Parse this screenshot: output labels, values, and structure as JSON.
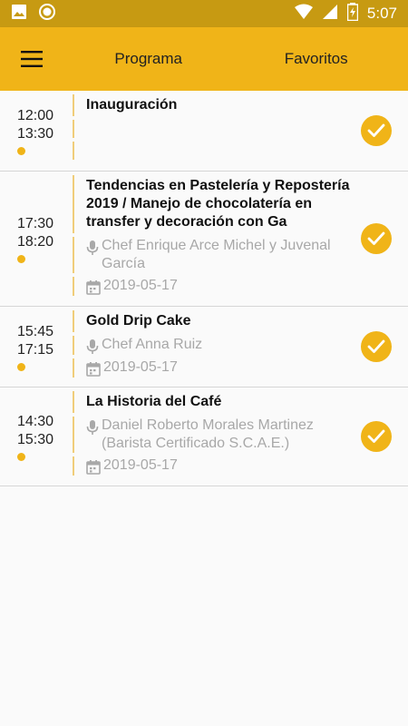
{
  "status_bar": {
    "time": "5:07",
    "icons": [
      "image-icon",
      "circle-icon",
      "wifi-icon",
      "signal-icon",
      "battery-icon"
    ]
  },
  "app_bar": {
    "menu_icon": "hamburger-menu-icon",
    "tabs": [
      {
        "label": "Programa"
      },
      {
        "label": "Favoritos"
      }
    ]
  },
  "sessions": [
    {
      "start": "12:00",
      "end": "13:30",
      "title": "Inauguración",
      "speaker": "",
      "date": "",
      "favorite": true
    },
    {
      "start": "17:30",
      "end": "18:20",
      "title": "Tendencias en Pastelería y Repostería 2019 /  Manejo de chocolatería en transfer y decoración con Ga",
      "speaker": "Chef Enrique Arce Michel y Juvenal García",
      "date": "2019-05-17",
      "favorite": true
    },
    {
      "start": "15:45",
      "end": "17:15",
      "title": "Gold Drip Cake",
      "speaker": "Chef Anna Ruiz",
      "date": "2019-05-17",
      "favorite": true
    },
    {
      "start": "14:30",
      "end": "15:30",
      "title": "La Historia del Café",
      "speaker": "Daniel Roberto Morales Martinez (Barista Certificado S.C.A.E.)",
      "date": "2019-05-17",
      "favorite": true
    }
  ],
  "colors": {
    "accent": "#f0b418",
    "status_bar": "#c79a12",
    "divider": "#f0cd7a",
    "meta_text": "#a8a8a8"
  }
}
